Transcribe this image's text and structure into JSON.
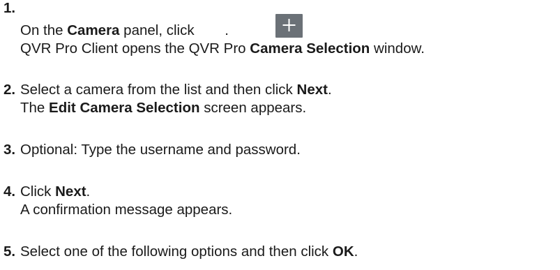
{
  "steps": [
    {
      "number": "1.",
      "lines": [
        {
          "pre": "On the ",
          "b1": "Camera",
          "mid": " panel, click ",
          "post": "."
        },
        {
          "pre": "QVR Pro Client opens the QVR Pro ",
          "b1": "Camera Selection",
          "post": " window."
        }
      ],
      "icon": "plus-icon"
    },
    {
      "number": "2.",
      "lines": [
        {
          "pre": "Select a camera from the list and then click ",
          "b1": "Next",
          "post": "."
        },
        {
          "pre": "The ",
          "b1": "Edit Camera Selection",
          "post": " screen appears."
        }
      ]
    },
    {
      "number": "3.",
      "lines": [
        {
          "pre": "Optional: Type the username and password."
        }
      ]
    },
    {
      "number": "4.",
      "lines": [
        {
          "pre": "Click ",
          "b1": "Next",
          "post": "."
        },
        {
          "pre": "A confirmation message appears."
        }
      ]
    },
    {
      "number": "5.",
      "lines": [
        {
          "pre": "Select one of the following options and then click ",
          "b1": "OK",
          "post": "."
        }
      ]
    }
  ],
  "colors": {
    "text": "#1a1a1a",
    "button_bg": "#6b7177",
    "button_fg": "#ffffff"
  }
}
